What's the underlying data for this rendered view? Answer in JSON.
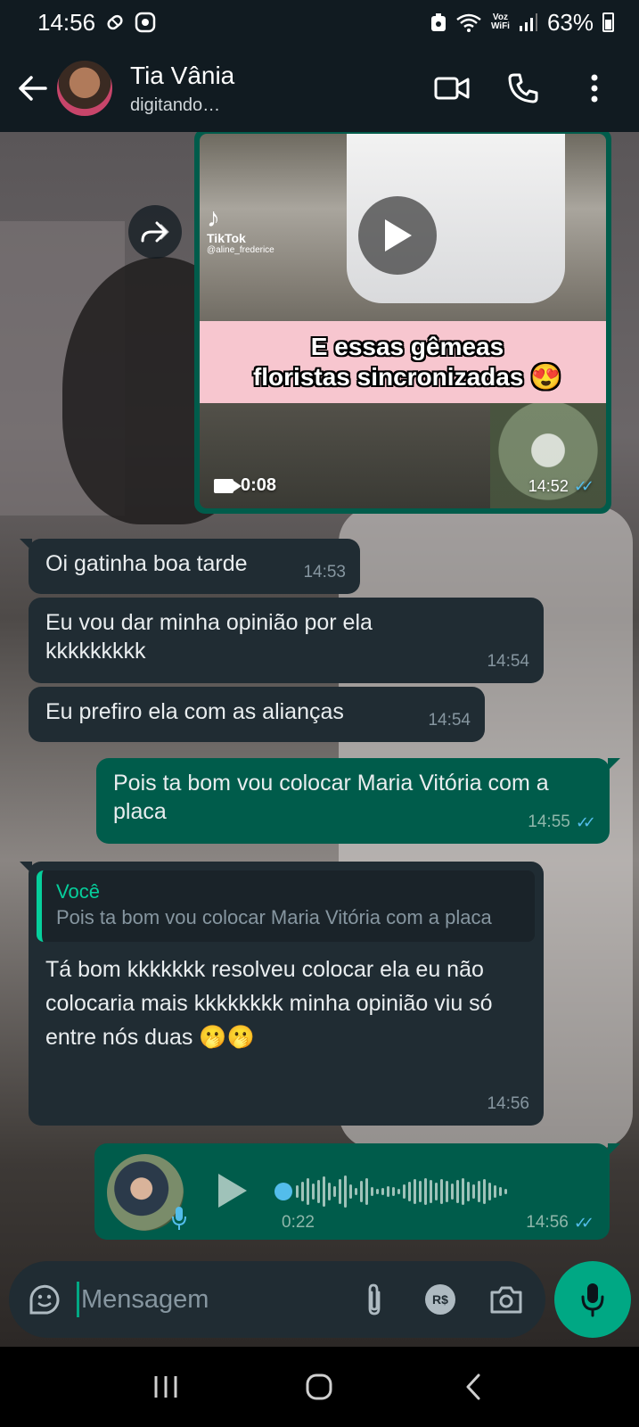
{
  "status_bar": {
    "time": "14:56",
    "voz_line1": "Voz",
    "voz_line2": "WiFi",
    "battery": "63%",
    "icons": [
      "tag-icon",
      "whatsapp-icon",
      "recycle-icon",
      "wifi-icon",
      "signal-icon",
      "battery-icon"
    ]
  },
  "header": {
    "contact_name": "Tia Vânia",
    "contact_status": "digitando…"
  },
  "video_message": {
    "tiktok_label": "TikTok",
    "tiktok_handle": "@aline_frederice",
    "caption_line1": "E essas gêmeas",
    "caption_line2": "floristas sincronizadas 😍",
    "duration": "0:08",
    "time": "14:52",
    "status": "read"
  },
  "messages": [
    {
      "direction": "in",
      "text": "Oi gatinha boa tarde",
      "time": "14:53"
    },
    {
      "direction": "in",
      "text": "Eu vou dar minha opinião por ela kkkkkkkkk",
      "time": "14:54"
    },
    {
      "direction": "in",
      "text": "Eu prefiro ela com as alianças",
      "time": "14:54"
    },
    {
      "direction": "out",
      "text": "Pois ta bom vou colocar Maria Vitória com a placa",
      "time": "14:55",
      "status": "read"
    },
    {
      "direction": "in",
      "quote_author": "Você",
      "quote_text": "Pois ta bom vou colocar Maria Vitória com a placa",
      "text": "Tá bom kkkkkkk resolveu colocar ela eu não colocaria mais kkkkkkkk minha opinião viu só entre nós duas 🫢🫢",
      "time": "14:56"
    }
  ],
  "audio_message": {
    "duration": "0:22",
    "time": "14:56",
    "status": "read",
    "progress": 0
  },
  "composer": {
    "placeholder": "Mensagem",
    "pay_label": "R$"
  },
  "colors": {
    "header_bg": "#111b21",
    "incoming_bubble": "#202c33",
    "outgoing_bubble": "#005c4b",
    "accent_green": "#00a884",
    "read_ticks": "#53bdeb"
  }
}
